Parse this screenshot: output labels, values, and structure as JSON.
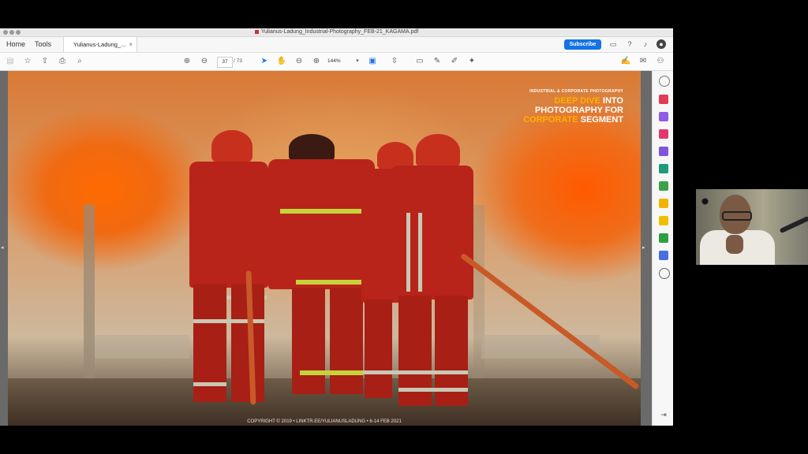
{
  "window": {
    "title": "Yulianus-Ladung_Industrial-Photography_FEB-21_KAGAMA.pdf"
  },
  "menubar": {
    "home": "Home",
    "tools": "Tools",
    "tab_label": "Yulianus-Ladung_...",
    "tab_close": "×",
    "subscribe": "Subscribe"
  },
  "toolbar": {
    "current_page": "37",
    "total_pages": "/ 73",
    "zoom": "144%"
  },
  "document": {
    "overlay_small": "INDUSTRIAL & CORPORATE PHOTOGRAPHY",
    "overlay_line1_orange": "DEEP DIVE",
    "overlay_line1_white": " INTO",
    "overlay_line2": "PHOTOGRAPHY FOR",
    "overlay_line3_orange": "CORPORATE",
    "overlay_line3_white": " SEGMENT",
    "copyright": "COPYRIGHT © 2019 • LINKTR.EE/YULIANUSLADUNG • 6-14 FEB 2021"
  },
  "colors": {
    "accent": "#1473e6",
    "overlay_orange": "#ffb000"
  }
}
